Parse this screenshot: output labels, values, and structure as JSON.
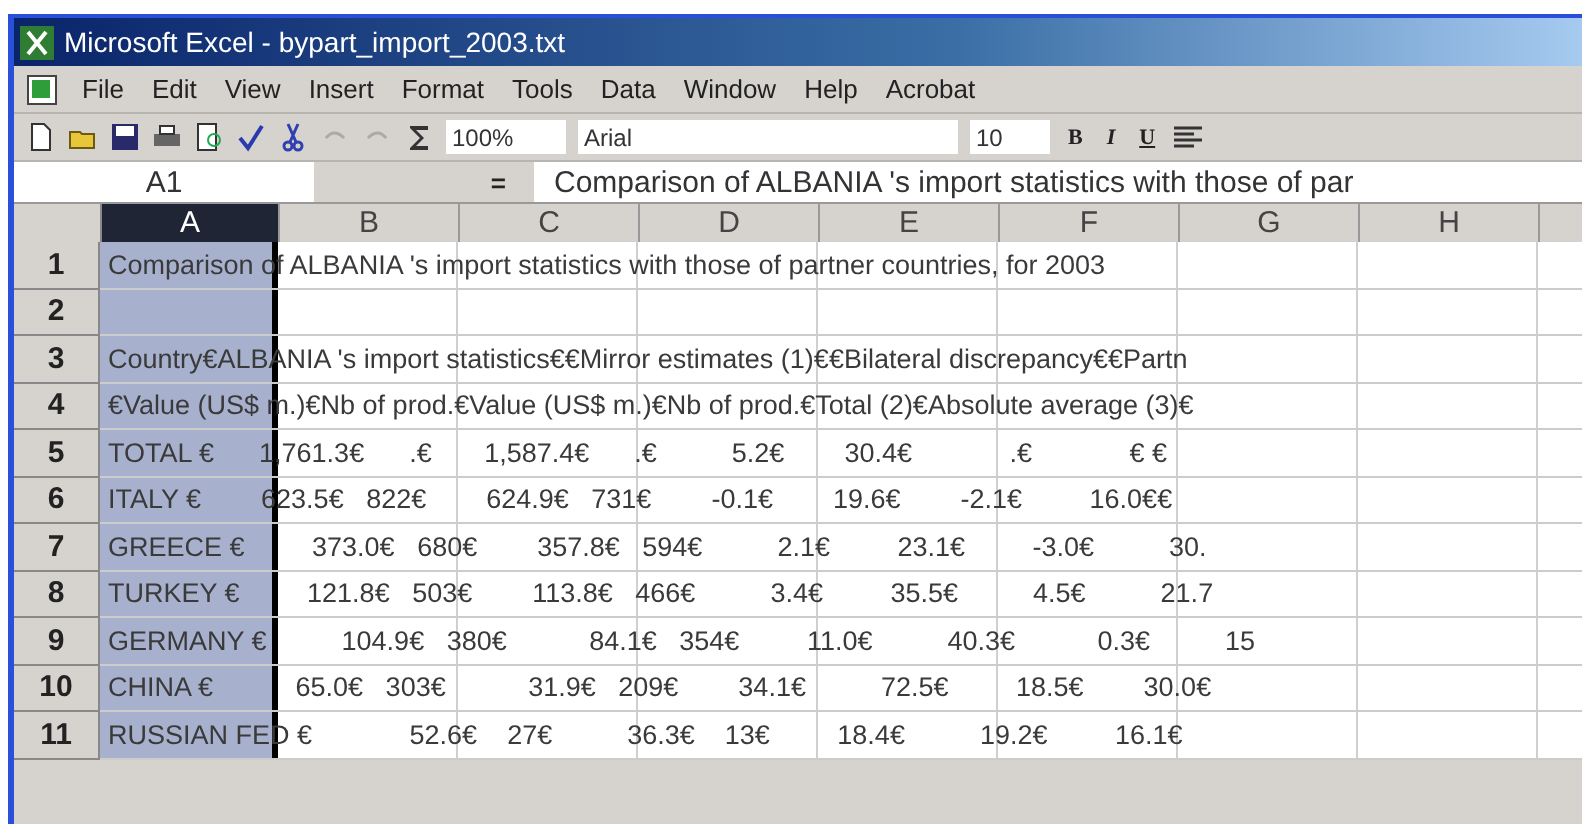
{
  "window": {
    "title": "Microsoft Excel - bypart_import_2003.txt"
  },
  "menu": [
    "File",
    "Edit",
    "View",
    "Insert",
    "Format",
    "Tools",
    "Data",
    "Window",
    "Help",
    "Acrobat"
  ],
  "toolbar": {
    "zoom": "100%",
    "font": "Arial",
    "size": "10",
    "format_buttons": [
      "B",
      "I",
      "U"
    ]
  },
  "formula_bar": {
    "name_box": "A1",
    "formula_button": "=",
    "content": "Comparison of ALBANIA 's import statistics with those of par"
  },
  "columns": [
    {
      "label": "A",
      "selected": true
    },
    {
      "label": "B",
      "selected": false
    },
    {
      "label": "C",
      "selected": false
    },
    {
      "label": "D",
      "selected": false
    },
    {
      "label": "E",
      "selected": false
    },
    {
      "label": "F",
      "selected": false
    },
    {
      "label": "G",
      "selected": false
    },
    {
      "label": "H",
      "selected": false
    }
  ],
  "rows": [
    {
      "number": "1",
      "text": "Comparison of ALBANIA 's import statistics with those of partner countries, for 2003"
    },
    {
      "number": "2",
      "text": ""
    },
    {
      "number": "3",
      "text": "Country€ALBANIA 's import statistics€€Mirror estimates (1)€€Bilateral discrepancy€€Partn"
    },
    {
      "number": "4",
      "text": "€Value (US$ m.)€Nb of prod.€Value (US$ m.)€Nb of prod.€Total (2)€Absolute average (3)€"
    },
    {
      "number": "5",
      "text": "TOTAL €      1,761.3€      .€       1,587.4€      .€          5.2€        30.4€             .€             € €"
    },
    {
      "number": "6",
      "text": "ITALY €        623.5€   822€        624.9€   731€        -0.1€        19.6€        -2.1€         16.0€€"
    },
    {
      "number": "7",
      "text": "GREECE €         373.0€   680€        357.8€   594€          2.1€         23.1€         -3.0€          30."
    },
    {
      "number": "8",
      "text": "TURKEY €         121.8€   503€        113.8€   466€          3.4€         35.5€          4.5€          21.7"
    },
    {
      "number": "9",
      "text": "GERMANY €          104.9€   380€           84.1€   354€         11.0€          40.3€           0.3€          15"
    },
    {
      "number": "10",
      "text": "CHINA €           65.0€   303€           31.9€   209€        34.1€          72.5€         18.5€        30.0€"
    },
    {
      "number": "11",
      "text": "RUSSIAN FED €             52.6€    27€          36.3€    13€         18.4€          19.2€         16.1€"
    }
  ]
}
